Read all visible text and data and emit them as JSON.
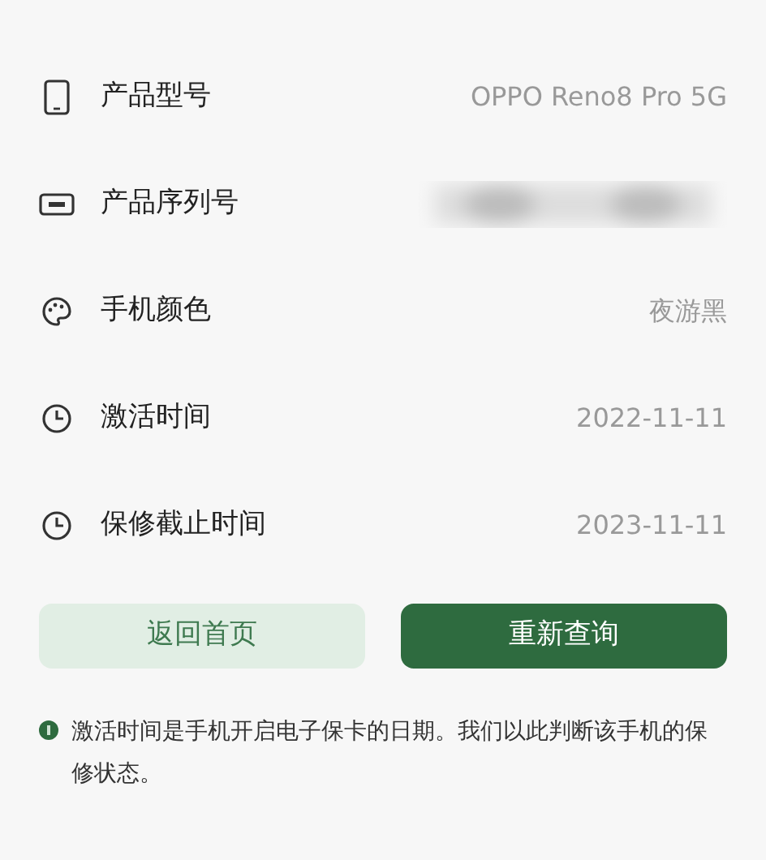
{
  "rows": [
    {
      "kind": "phone",
      "label": "产品型号",
      "value": "OPPO Reno8 Pro 5G"
    },
    {
      "kind": "card",
      "label": "产品序列号",
      "blurred": true
    },
    {
      "kind": "palette",
      "label": "手机颜色",
      "value": "夜游黑"
    },
    {
      "kind": "clock",
      "label": "激活时间",
      "value": "2022-11-11"
    },
    {
      "kind": "clock",
      "label": "保修截止时间",
      "value": "2023-11-11"
    }
  ],
  "buttons": [
    {
      "label": "返回首页",
      "kind": "secondary"
    },
    {
      "label": "重新查询",
      "kind": "primary"
    }
  ],
  "note": "激活时间是手机开启电子保卡的日期。我们以此判断该手机的保修状态。"
}
